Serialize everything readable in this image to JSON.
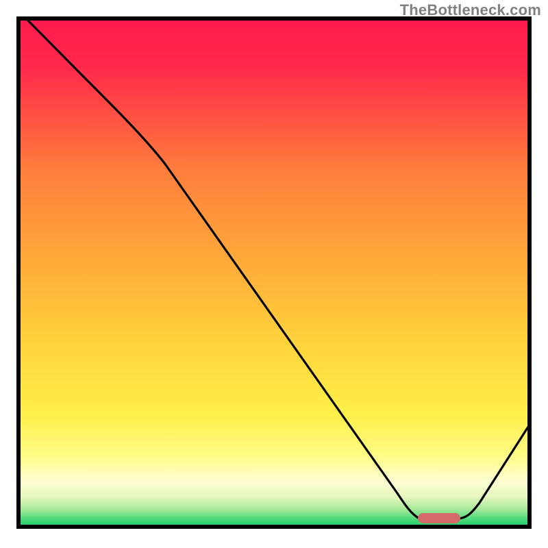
{
  "watermark": "TheBottleneck.com",
  "chart_data": {
    "type": "line",
    "title": "",
    "xlabel": "",
    "ylabel": "",
    "xlim": [
      0,
      1
    ],
    "ylim": [
      0,
      1
    ],
    "background_gradient_stops": [
      {
        "offset": 0.0,
        "color": "#ff1a4d"
      },
      {
        "offset": 0.3,
        "color": "#ff7e3c"
      },
      {
        "offset": 0.65,
        "color": "#ffd63c"
      },
      {
        "offset": 0.91,
        "color": "#fefed2"
      },
      {
        "offset": 1.0,
        "color": "#1fcf6a"
      }
    ],
    "series": [
      {
        "name": "bottleneck-curve",
        "x": [
          0.02,
          0.12,
          0.28,
          0.74,
          0.79,
          0.86,
          1.0
        ],
        "y": [
          1.0,
          0.8,
          0.7,
          0.06,
          0.02,
          0.02,
          0.2
        ]
      }
    ],
    "marker": {
      "name": "optimal-point",
      "x_range": [
        0.79,
        0.87
      ],
      "y": 0.02,
      "color": "#d46a6a"
    },
    "annotations": []
  }
}
